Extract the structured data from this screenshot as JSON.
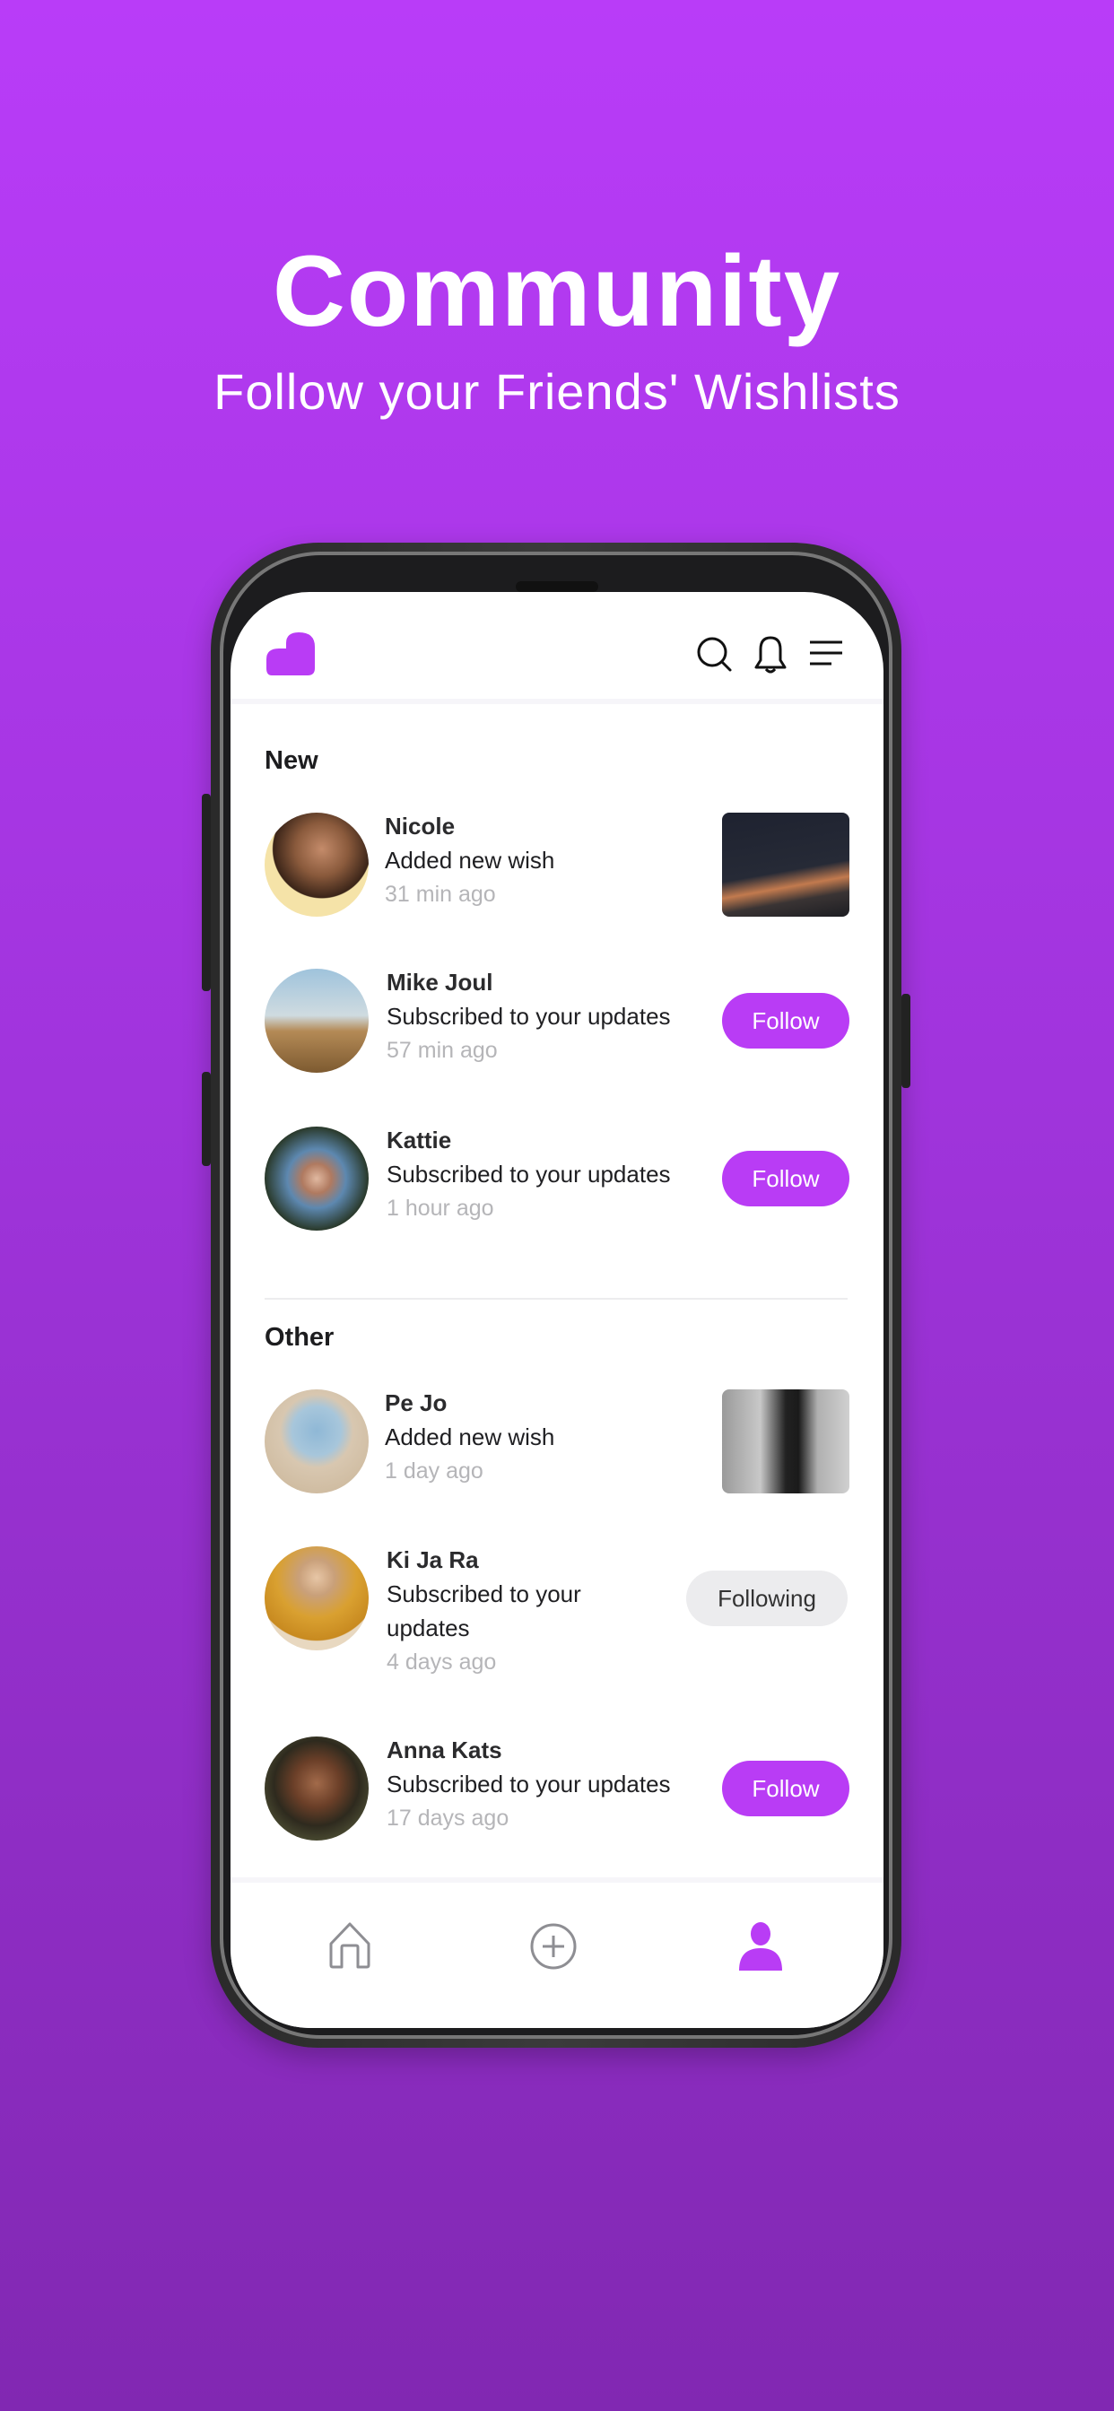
{
  "hero": {
    "title": "Community",
    "subtitle": "Follow your Friends' Wishlists"
  },
  "colors": {
    "accent": "#b93cf5",
    "background_top": "#b93cf8",
    "background_bottom": "#8128b2"
  },
  "header": {
    "icons": [
      "cloud-logo",
      "search-icon",
      "bell-icon",
      "menu-icon"
    ]
  },
  "sections": [
    {
      "title": "New",
      "items": [
        {
          "name": "Nicole",
          "activity": "Added new wish",
          "time": "31 min ago",
          "action": "thumbnail"
        },
        {
          "name": "Mike Joul",
          "activity": "Subscribed to your updates",
          "time": "57 min ago",
          "action": "Follow"
        },
        {
          "name": "Kattie",
          "activity": "Subscribed to your updates",
          "time": "1 hour ago",
          "action": "Follow"
        }
      ]
    },
    {
      "title": "Other",
      "items": [
        {
          "name": "Pe Jo",
          "activity": "Added new wish",
          "time": "1 day ago",
          "action": "thumbnail"
        },
        {
          "name": "Ki Ja Ra",
          "activity": "Subscribed to your updates",
          "time": "4 days ago",
          "action": "Following"
        },
        {
          "name": "Anna Kats",
          "activity": "Subscribed to your updates",
          "time": "17 days ago",
          "action": "Follow"
        }
      ]
    }
  ],
  "nav": {
    "items": [
      "home",
      "add",
      "profile"
    ],
    "active": "profile"
  }
}
